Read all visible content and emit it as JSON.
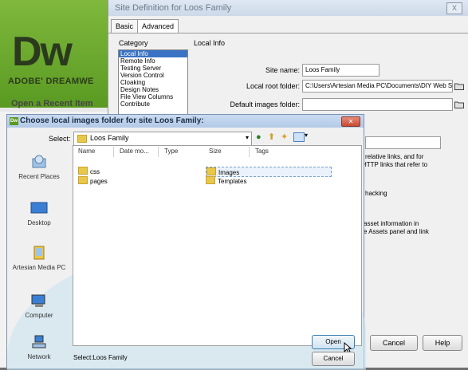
{
  "dreamweaver": {
    "logo": "Dw",
    "product": "ADOBE' DREAMWE",
    "open_recent": "Open a Recent Item"
  },
  "site_dialog": {
    "title": "Site Definition for Loos Family",
    "close": "X",
    "tabs": [
      "Basic",
      "Advanced"
    ],
    "category_label": "Category",
    "section_label": "Local Info",
    "categories": [
      "Local Info",
      "Remote Info",
      "Testing Server",
      "Version Control",
      "Cloaking",
      "Design Notes",
      "File View Columns",
      "Contribute"
    ],
    "selected_category": "Local Info",
    "fields": [
      {
        "label": "Site name:",
        "value": "Loos Family"
      },
      {
        "label": "Local root folder:",
        "value": "C:\\Users\\Artesian Media PC\\Documents\\DIY Web S"
      },
      {
        "label": "Default images folder:",
        "value": ""
      }
    ],
    "right_text_1a": "relative links, and for",
    "right_text_1b": "HTTP links that refer to",
    "right_text_2": "hacking",
    "right_text_3a": "asset information in",
    "right_text_3b": "e Assets panel and link",
    "cancel_label": "Cancel",
    "help_label": "Help"
  },
  "choose_dialog": {
    "title": "Choose local images folder for site Loos Family:",
    "select_label": "Select:",
    "select_value": "Loos Family",
    "columns": [
      "Name",
      "Date mo...",
      "Type",
      "Size",
      "Tags"
    ],
    "left_files": [
      "css",
      "pages"
    ],
    "right_files": [
      "Images",
      "Templates"
    ],
    "places": [
      "Recent Places",
      "Desktop",
      "Artesian Media PC",
      "Computer",
      "Network"
    ],
    "status": "Select:Loos Family",
    "open_label": "Open",
    "cancel_label": "Cancel"
  }
}
